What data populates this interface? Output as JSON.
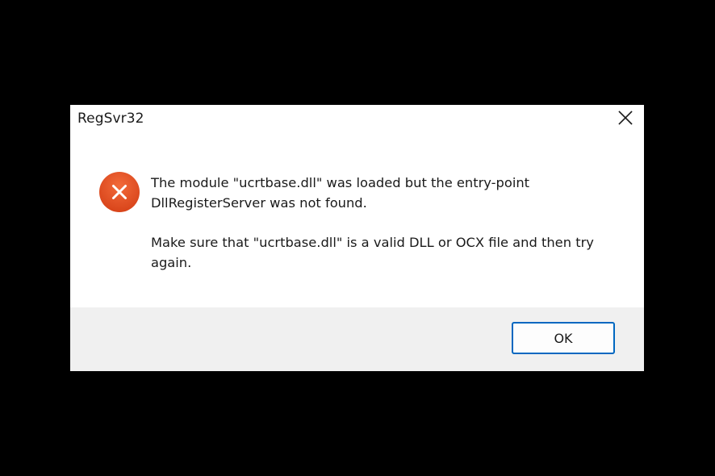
{
  "window": {
    "title": "RegSvr32",
    "close_icon": "close-icon"
  },
  "dialog": {
    "icon": "error-icon",
    "message_line_1": "The module \"ucrtbase.dll\" was loaded but the entry-point DllRegisterServer was not found.",
    "message_line_2": "Make sure that \"ucrtbase.dll\" is a valid DLL or OCX file and then try again.",
    "ok_label": "OK"
  },
  "colors": {
    "error_red": "#e04e1f",
    "button_border": "#0067c0",
    "footer_bg": "#f0f0f0",
    "backdrop": "#000000"
  }
}
